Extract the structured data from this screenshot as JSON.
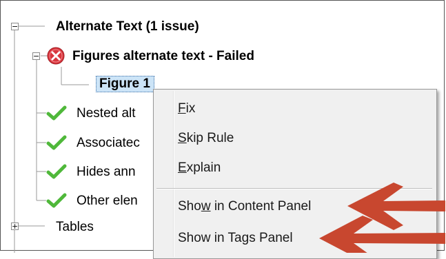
{
  "tree": {
    "alternate_text_group": "Alternate Text (1 issue)",
    "figures_rule": "Figures alternate text - Failed",
    "figure_item": "Figure 1",
    "nested_rule": "Nested alt",
    "associated_rule": "Associatec",
    "hides_rule": "Hides ann",
    "other_rule": "Other elen",
    "tables_group": "Tables",
    "expander_collapse": "−",
    "expander_expand": "+"
  },
  "context_menu": {
    "items": [
      {
        "pre": "",
        "accel": "F",
        "post": "ix"
      },
      {
        "pre": "",
        "accel": "S",
        "post": "kip Rule"
      },
      {
        "pre": "",
        "accel": "E",
        "post": "xplain"
      },
      {
        "pre": "Sho",
        "accel": "w",
        "post": " in Content Panel"
      },
      {
        "pre": "Show in Ta",
        "accel": "g",
        "post": "s Panel"
      }
    ]
  },
  "colors": {
    "fail_icon": "#d9363e",
    "pass_check": "#4fb83a",
    "annotation_arrow": "#c8472f",
    "selection": "#cce4f7"
  },
  "icons": {
    "fail": "red-x-circle-icon",
    "pass": "green-checkmark-icon",
    "annotation": "red-arrow-annotation"
  }
}
